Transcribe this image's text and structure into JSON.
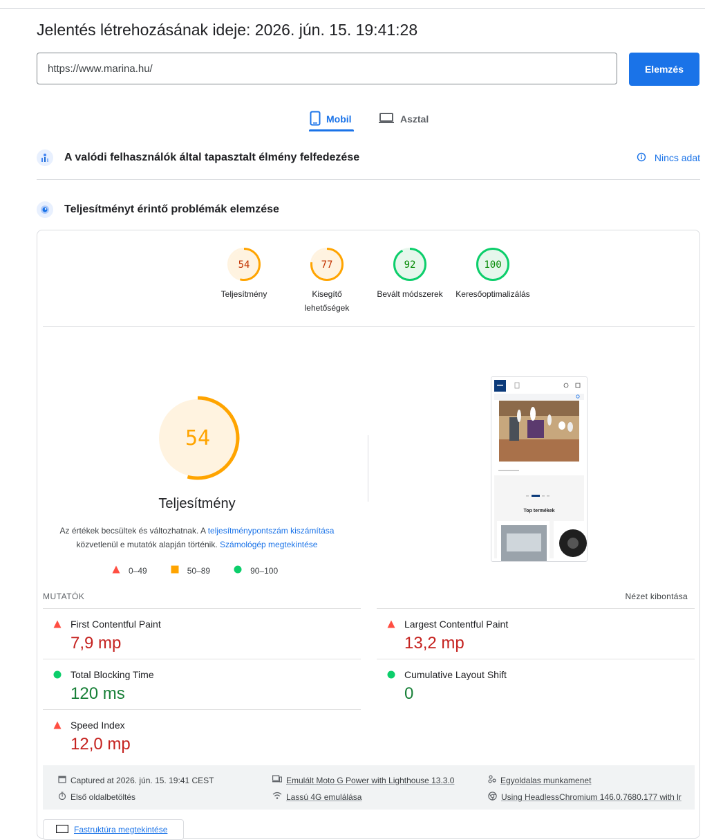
{
  "report": {
    "title": "Jelentés létrehozásának ideje: 2026. jún. 15. 19:41:28"
  },
  "url_input": {
    "value": "https://www.marina.hu/"
  },
  "analyze_button": {
    "label": "Elemzés"
  },
  "device_tabs": {
    "mobile": "Mobil",
    "desktop": "Asztal",
    "selected": "mobile"
  },
  "crux": {
    "title": "A valódi felhasználók által tapasztalt élmény felfedezése",
    "no_data": "Nincs adat"
  },
  "diagnose": {
    "title": "Teljesítményt érintő problémák elemzése"
  },
  "categories": [
    {
      "score": "54",
      "label": "Teljesítmény",
      "status": "average",
      "fraction": 0.54
    },
    {
      "score": "77",
      "label": "Kisegítő lehetőségek",
      "status": "average",
      "fraction": 0.77
    },
    {
      "score": "92",
      "label": "Bevált módszerek",
      "status": "pass",
      "fraction": 0.92
    },
    {
      "score": "100",
      "label": "Keresőoptimalizálás",
      "status": "pass",
      "fraction": 1.0
    }
  ],
  "performance": {
    "score": "54",
    "fraction": 0.54,
    "title": "Teljesítmény",
    "desc_prefix": "Az értékek becsültek és változhatnak. A",
    "desc_link1": "teljesítménypontszám kiszámítása",
    "desc_mid": "közvetlenül e mutatók alapján történik.",
    "desc_link2": "Számológép megtekintése"
  },
  "legend": {
    "fail": "0–49",
    "average": "50–89",
    "pass": "90–100"
  },
  "screenshot": {
    "section_label": "Top termékek"
  },
  "metrics": {
    "heading": "MUTATÓK",
    "expand": "Nézet kibontása",
    "fcp": {
      "name": "First Contentful Paint",
      "value": "7,9 mp",
      "status": "fail"
    },
    "lcp": {
      "name": "Largest Contentful Paint",
      "value": "13,2 mp",
      "status": "fail"
    },
    "tbt": {
      "name": "Total Blocking Time",
      "value": "120 ms",
      "status": "pass"
    },
    "cls": {
      "name": "Cumulative Layout Shift",
      "value": "0",
      "status": "pass"
    },
    "si": {
      "name": "Speed Index",
      "value": "12,0 mp",
      "status": "fail"
    }
  },
  "env": {
    "captured": "Captured at 2026. jún. 15. 19:41 CEST",
    "device": "Emulált Moto G Power with Lighthouse 13.3.0",
    "session": "Egyoldalas munkamenet",
    "load": "Első oldalbetöltés",
    "network": "Lassú 4G emulálása",
    "browser": "Using HeadlessChromium 146.0.7680.177 with lr"
  },
  "treemap_button": {
    "label": "Fastruktúra megtekintése"
  },
  "colors": {
    "accent": "#1a73e8",
    "fail": "#ff4e42",
    "average": "#ffa400",
    "pass": "#0cce6b"
  }
}
